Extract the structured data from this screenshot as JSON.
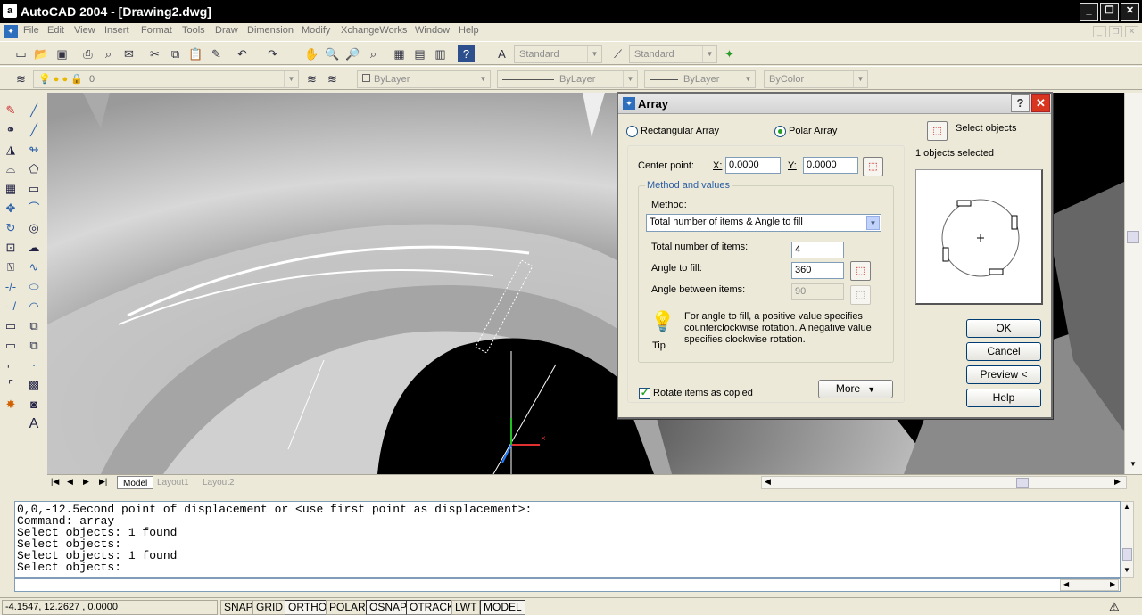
{
  "window": {
    "title": "AutoCAD 2004 - [Drawing2.dwg]",
    "app_icon_letter": "a",
    "controls": [
      "_",
      "❐",
      "✕"
    ]
  },
  "menu": {
    "items": [
      "File",
      "Edit",
      "View",
      "Insert",
      "Format",
      "Tools",
      "Draw",
      "Dimension",
      "Modify",
      "XchangeWorks",
      "Window",
      "Help"
    ]
  },
  "toolbar": {
    "text_style": "Standard",
    "dim_style": "Standard"
  },
  "layers": {
    "current_layer": "0",
    "color": "ByLayer",
    "linetype": "ByLayer",
    "lineweight": "ByLayer",
    "plotstyle": "ByColor"
  },
  "layout_tabs": [
    "Model",
    "Layout1",
    "Layout2"
  ],
  "command_history": [
    "0,0,-12.5econd point of displacement or <use first point as displacement>:",
    "Command: array",
    "Select objects: 1 found",
    "Select objects:",
    "Select objects: 1 found",
    "Select objects:"
  ],
  "status": {
    "coordinates": "-4.1547, 12.2627 , 0.0000",
    "toggles": [
      {
        "label": "SNAP",
        "on": false
      },
      {
        "label": "GRID",
        "on": false
      },
      {
        "label": "ORTHO",
        "on": true
      },
      {
        "label": "POLAR",
        "on": false
      },
      {
        "label": "OSNAP",
        "on": true
      },
      {
        "label": "OTRACK",
        "on": true
      },
      {
        "label": "LWT",
        "on": false
      },
      {
        "label": "MODEL",
        "on": true
      }
    ]
  },
  "dialog": {
    "title": "Array",
    "help_glyph": "?",
    "close_glyph": "✕",
    "rectangular_label": "Rectangular Array",
    "polar_label": "Polar Array",
    "selected_mode": "polar",
    "select_objects_label": "Select objects",
    "objects_selected": "1 objects selected",
    "center_point_label": "Center point:",
    "x_label": "X:",
    "x_value": "0.0000",
    "y_label": "Y:",
    "y_value": "0.0000",
    "group_label": "Method and values",
    "method_label": "Method:",
    "method_value": "Total number of items & Angle to fill",
    "total_items_label": "Total number of items:",
    "total_items_value": "4",
    "angle_fill_label": "Angle to fill:",
    "angle_fill_value": "360",
    "angle_between_label": "Angle between items:",
    "angle_between_value": "90",
    "tip_text": "For angle to fill, a positive value specifies counterclockwise rotation.  A negative value specifies clockwise rotation.",
    "tip_label": "Tip",
    "rotate_label": "Rotate items as copied",
    "rotate_checked": true,
    "more_label": "More",
    "ok_label": "OK",
    "cancel_label": "Cancel",
    "preview_label": "Preview <",
    "help_label": "Help"
  }
}
